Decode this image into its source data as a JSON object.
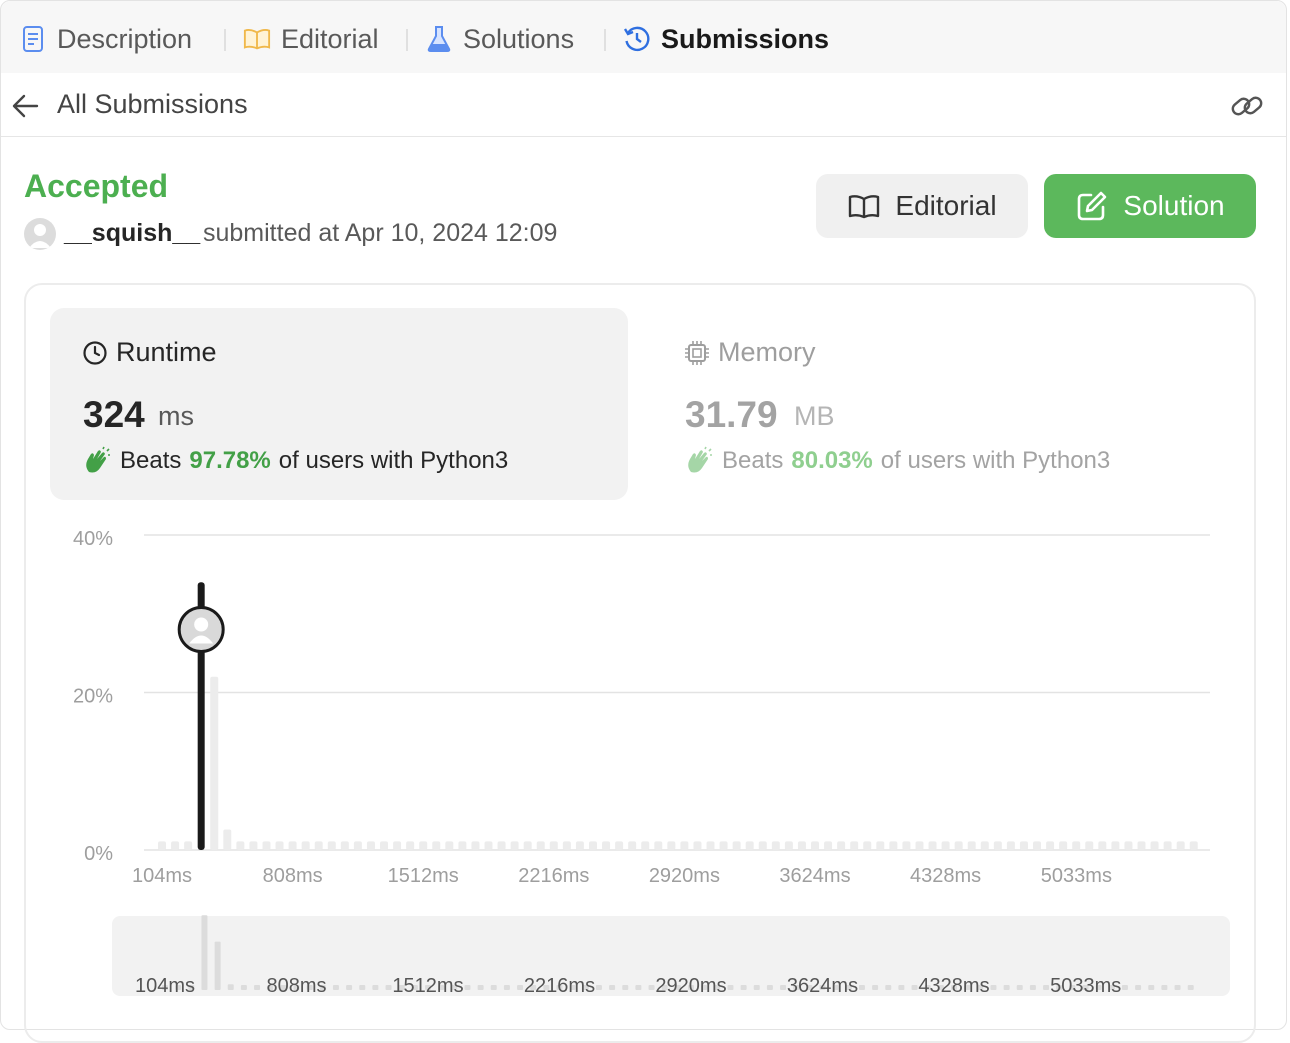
{
  "tabs": [
    {
      "label": "Description",
      "icon": "description-icon"
    },
    {
      "label": "Editorial",
      "icon": "book-icon"
    },
    {
      "label": "Solutions",
      "icon": "flask-icon"
    },
    {
      "label": "Submissions",
      "icon": "history-icon",
      "active": true
    }
  ],
  "header": {
    "back_label": "All Submissions"
  },
  "submission": {
    "status": "Accepted",
    "username": "__squish__",
    "submitted_text": "submitted at Apr 10, 2024 12:09"
  },
  "buttons": {
    "editorial": "Editorial",
    "solution": "Solution"
  },
  "runtime": {
    "label": "Runtime",
    "value": "324",
    "unit": "ms",
    "beats_prefix": "Beats",
    "beats_pct": "97.78%",
    "beats_suffix": "of users with Python3"
  },
  "memory": {
    "label": "Memory",
    "value": "31.79",
    "unit": "MB",
    "beats_prefix": "Beats",
    "beats_pct": "80.03%",
    "beats_suffix": "of users with Python3"
  },
  "colors": {
    "accent_green": "#4caf50",
    "button_green": "#5cb85c",
    "light_green": "#8fcf8f"
  },
  "chart_data": {
    "type": "bar",
    "xlabel": "",
    "ylabel": "",
    "ytick_labels": [
      "40%",
      "20%",
      "0%"
    ],
    "yticks": [
      40,
      20,
      0
    ],
    "ylim": [
      0,
      40
    ],
    "xtick_labels": [
      "104ms",
      "808ms",
      "1512ms",
      "2216ms",
      "2920ms",
      "3624ms",
      "4328ms",
      "5033ms"
    ],
    "xtick_values": [
      104,
      808,
      1512,
      2216,
      2920,
      3624,
      4328,
      5033
    ],
    "bin_start_ms": 104,
    "bin_width_ms": 70.4,
    "values": [
      1.1,
      1.1,
      1.1,
      34,
      22,
      2.6,
      1.1,
      1.1,
      1.1,
      1.1,
      1.1,
      1.1,
      1.1,
      1.1,
      1.1,
      1.1,
      1.1,
      1.1,
      1.1,
      1.1,
      1.1,
      1.1,
      1.1,
      1.1,
      1.1,
      1.1,
      1.1,
      1.1,
      1.1,
      1.1,
      1.1,
      1.1,
      1.1,
      1.1,
      1.1,
      1.1,
      1.1,
      1.1,
      1.1,
      1.1,
      1.1,
      1.1,
      1.1,
      1.1,
      1.1,
      1.1,
      1.1,
      1.1,
      1.1,
      1.1,
      1.1,
      1.1,
      1.1,
      1.1,
      1.1,
      1.1,
      1.1,
      1.1,
      1.1,
      1.1,
      1.1,
      1.1,
      1.1,
      1.1,
      1.1,
      1.1,
      1.1,
      1.1,
      1.1,
      1.1,
      1.1,
      1.1,
      1.1,
      1.1,
      1.1,
      1.1,
      1.1,
      1.1,
      1.1,
      1.1,
      1.1,
      1.1,
      1.1,
      1.1,
      1.1,
      1.1,
      1.1,
      1.1,
      1.1,
      1.1,
      1.1,
      1.1,
      1.1,
      1.1,
      1.1,
      1.1,
      1.1,
      1.1,
      1.1,
      1.1,
      1.1,
      1.1,
      1.1,
      1.1,
      1.1,
      1.1,
      1.1,
      1.1,
      1.1,
      1.1,
      1.1,
      1.1,
      1.1,
      1.1,
      1.1,
      1.1,
      1.1,
      1.1
    ],
    "user_runtime_ms": 324,
    "user_marker_y_pct": 28
  },
  "minimap": {
    "xtick_labels": [
      "104ms",
      "808ms",
      "1512ms",
      "2216ms",
      "2920ms",
      "3624ms",
      "4328ms",
      "5033ms"
    ]
  }
}
